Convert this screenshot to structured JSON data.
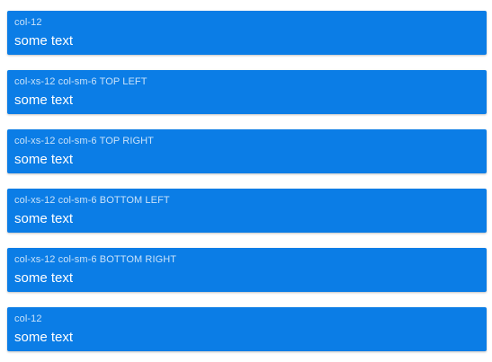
{
  "colors": {
    "card_background": "#0b7de6",
    "card_text": "#ffffff"
  },
  "cards": [
    {
      "class_label": "col-12",
      "text": "some text"
    },
    {
      "class_label": "col-xs-12 col-sm-6 TOP LEFT",
      "text": "some text"
    },
    {
      "class_label": "col-xs-12 col-sm-6 TOP RIGHT",
      "text": "some text"
    },
    {
      "class_label": "col-xs-12 col-sm-6 BOTTOM LEFT",
      "text": "some text"
    },
    {
      "class_label": "col-xs-12 col-sm-6 BOTTOM RIGHT",
      "text": "some text"
    },
    {
      "class_label": "col-12",
      "text": "some text"
    }
  ]
}
